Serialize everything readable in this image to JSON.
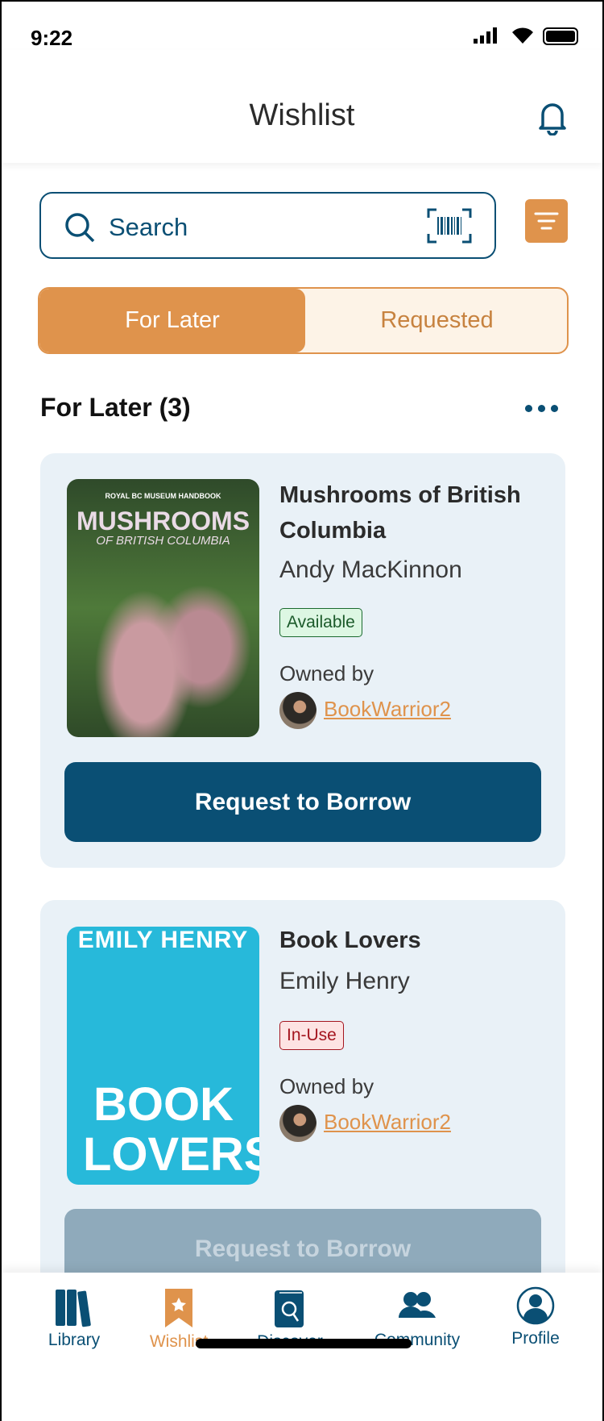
{
  "status": {
    "time": "9:22"
  },
  "header": {
    "title": "Wishlist"
  },
  "search": {
    "placeholder": "Search"
  },
  "tabs": [
    {
      "label": "For Later",
      "active": true
    },
    {
      "label": "Requested",
      "active": false
    }
  ],
  "section": {
    "title": "For Later (3)"
  },
  "books": [
    {
      "cover_title": "MUSHROOMS",
      "cover_subtitle": "OF BRITISH COLUMBIA",
      "cover_top": "ROYAL BC MUSEUM HANDBOOK",
      "title": "Mushrooms of British Columbia",
      "author": "Andy MacKinnon",
      "status": "Available",
      "owned_label": "Owned by",
      "owner": "BookWarrior2",
      "button": "Request to Borrow"
    },
    {
      "cover_title": "BOOK LOVERS",
      "cover_author": "EMILY HENRY",
      "title": "Book Lovers",
      "author": "Emily Henry",
      "status": "In-Use",
      "owned_label": "Owned by",
      "owner": "BookWarrior2",
      "button": "Request to Borrow"
    }
  ],
  "nav": [
    {
      "label": "Library"
    },
    {
      "label": "Wishlist",
      "active": true
    },
    {
      "label": "Discover"
    },
    {
      "label": "Community"
    },
    {
      "label": "Profile"
    }
  ],
  "colors": {
    "primary": "#0a4f74",
    "accent": "#df934c",
    "card": "#e9f1f7"
  }
}
